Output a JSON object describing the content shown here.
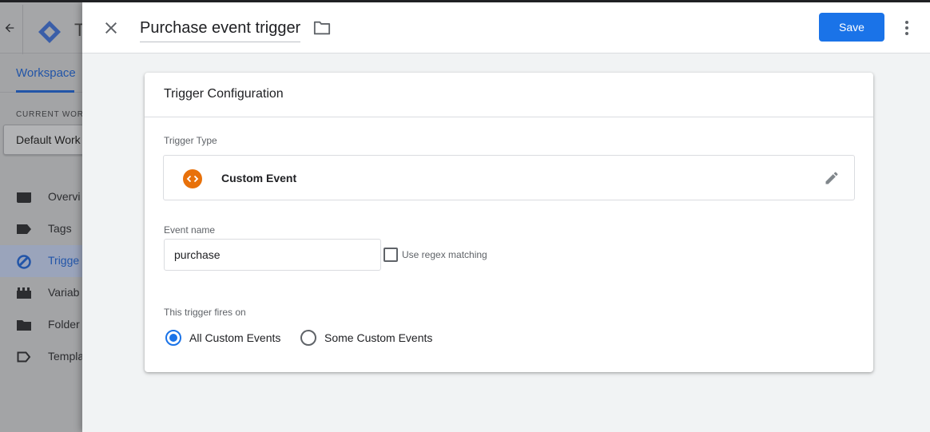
{
  "background": {
    "app_title": "T",
    "workspace_tab": "Workspace",
    "current_workspace_label": "CURRENT WORK",
    "current_workspace_value": "Default Work",
    "nav": [
      {
        "label": "Overvi",
        "icon": "overview-icon",
        "active": false
      },
      {
        "label": "Tags",
        "icon": "tag-icon",
        "active": false
      },
      {
        "label": "Trigge",
        "icon": "trigger-icon",
        "active": true
      },
      {
        "label": "Variab",
        "icon": "variables-icon",
        "active": false
      },
      {
        "label": "Folder",
        "icon": "folder-icon",
        "active": false
      },
      {
        "label": "Templa",
        "icon": "template-icon",
        "active": false
      }
    ]
  },
  "panel": {
    "title": "Purchase event trigger",
    "save_label": "Save",
    "card": {
      "title": "Trigger Configuration",
      "trigger_type_label": "Trigger Type",
      "trigger_type_name": "Custom Event",
      "event_name_label": "Event name",
      "event_name_value": "purchase",
      "regex_label": "Use regex matching",
      "regex_checked": false,
      "fires_on_label": "This trigger fires on",
      "fires_on_options": [
        {
          "label": "All Custom Events",
          "selected": true
        },
        {
          "label": "Some Custom Events",
          "selected": false
        }
      ]
    }
  },
  "colors": {
    "primary": "#1a73e8",
    "custom_event_icon": "#e8710a"
  }
}
